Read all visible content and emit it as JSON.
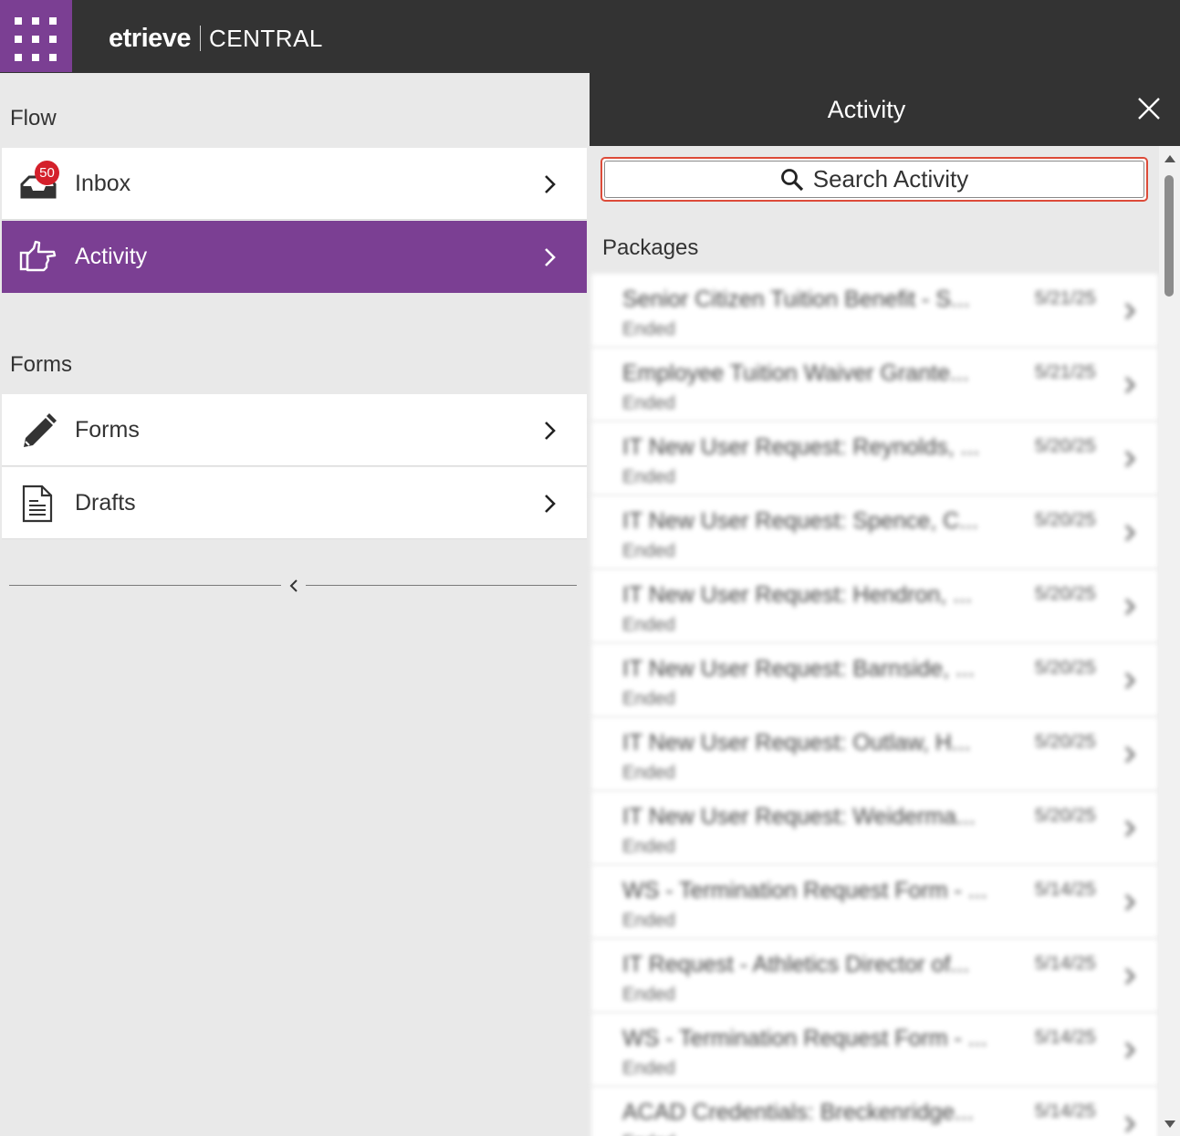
{
  "header": {
    "brand_logo": "etrieve",
    "brand_product": "CENTRAL",
    "launcher_icon": "app-grid-icon"
  },
  "sidebar": {
    "sections": [
      {
        "title": "Flow",
        "items": [
          {
            "label": "Inbox",
            "icon": "inbox-icon",
            "badge": "50",
            "active": false
          },
          {
            "label": "Activity",
            "icon": "pointing-hand-icon",
            "active": true
          }
        ]
      },
      {
        "title": "Forms",
        "items": [
          {
            "label": "Forms",
            "icon": "pencil-icon",
            "active": false
          },
          {
            "label": "Drafts",
            "icon": "document-icon",
            "active": false
          }
        ]
      }
    ],
    "collapse_icon": "chevron-left-icon"
  },
  "panel": {
    "title": "Activity",
    "close_icon": "close-icon",
    "search_placeholder": "Search Activity",
    "search_icon": "search-icon",
    "list_heading": "Packages",
    "rows": [
      {
        "title": "Senior Citizen Tuition Benefit - S...",
        "date": "5/21/25",
        "status": "Ended"
      },
      {
        "title": "Employee Tuition Waiver Grante...",
        "date": "5/21/25",
        "status": "Ended"
      },
      {
        "title": "IT New User Request: Reynolds, ...",
        "date": "5/20/25",
        "status": "Ended"
      },
      {
        "title": "IT New User Request: Spence, C...",
        "date": "5/20/25",
        "status": "Ended"
      },
      {
        "title": "IT New User Request: Hendron, ...",
        "date": "5/20/25",
        "status": "Ended"
      },
      {
        "title": "IT New User Request: Barnside, ...",
        "date": "5/20/25",
        "status": "Ended"
      },
      {
        "title": "IT New User Request: Outlaw, H...",
        "date": "5/20/25",
        "status": "Ended"
      },
      {
        "title": "IT New User Request: Weiderma...",
        "date": "5/20/25",
        "status": "Ended"
      },
      {
        "title": "WS - Termination Request Form - ...",
        "date": "5/14/25",
        "status": "Ended"
      },
      {
        "title": "IT Request - Athletics Director of...",
        "date": "5/14/25",
        "status": "Ended"
      },
      {
        "title": "WS - Termination Request Form - ...",
        "date": "5/14/25",
        "status": "Ended"
      },
      {
        "title": "ACAD Credentials: Breckenridge...",
        "date": "5/14/25",
        "status": "Ended"
      }
    ]
  },
  "colors": {
    "brand_purple": "#7b3f93",
    "header_dark": "#333333",
    "badge_red": "#d4202b",
    "search_focus": "#dd4b39"
  }
}
